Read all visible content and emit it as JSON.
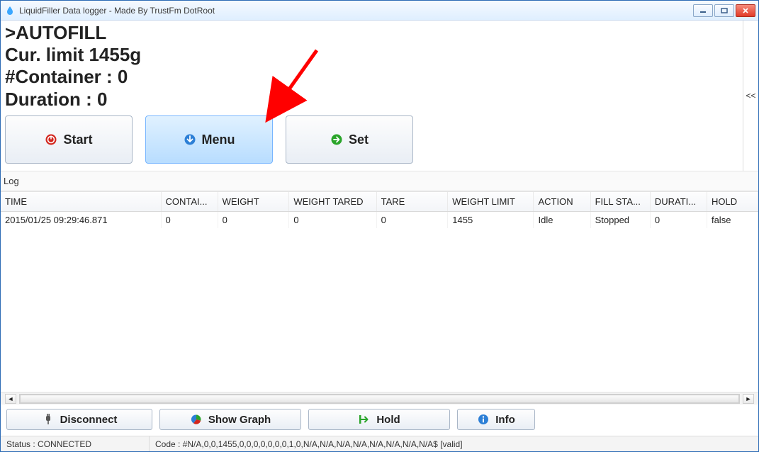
{
  "window": {
    "title": "LiquidFiller Data logger - Made By TrustFm DotRoot"
  },
  "display": {
    "line1": ">AUTOFILL",
    "line2": "Cur. limit 1455g",
    "line3": "#Container : 0",
    "line4": "Duration : 0"
  },
  "side_toggle": "<<",
  "buttons_top": {
    "start": "Start",
    "menu": "Menu",
    "set": "Set"
  },
  "log_label": "Log",
  "table": {
    "columns": [
      "TIME",
      "CONTAI...",
      "WEIGHT",
      "WEIGHT TARED",
      "TARE",
      "WEIGHT LIMIT",
      "ACTION",
      "FILL STA...",
      "DURATI...",
      "HOLD"
    ],
    "rows": [
      {
        "time": "2015/01/25 09:29:46.871",
        "container": "0",
        "weight": "0",
        "weight_tared": "0",
        "tare": "0",
        "weight_limit": "1455",
        "action": "Idle",
        "fill_state": "Stopped",
        "duration": "0",
        "hold": "false"
      }
    ]
  },
  "buttons_bottom": {
    "disconnect": "Disconnect",
    "show_graph": "Show Graph",
    "hold": "Hold",
    "info": "Info"
  },
  "status": {
    "left": "Status : CONNECTED",
    "right": "Code : #N/A,0,0,1455,0,0,0,0,0,0,0,1,0,N/A,N/A,N/A,N/A,N/A,N/A,N/A,N/A$ [valid]"
  }
}
